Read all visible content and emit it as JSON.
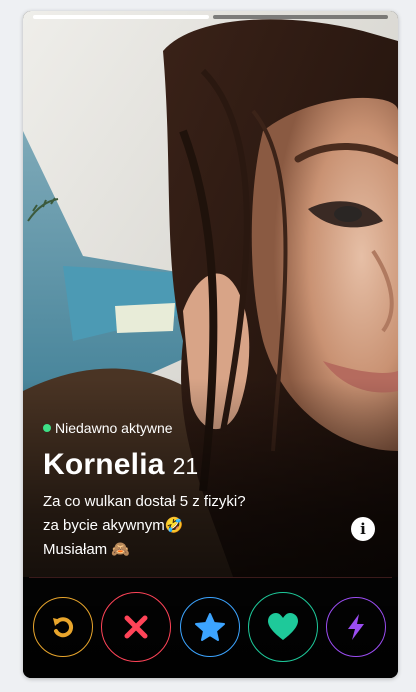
{
  "progress": {
    "total": 2,
    "active_index": 0
  },
  "profile": {
    "status": "Niedawno aktywne",
    "name": "Kornelia",
    "age": "21",
    "bio": [
      "Za co wulkan dostał 5 z fizyki?",
      "za bycie akywnym🤣",
      "Musiałam 🙈"
    ]
  },
  "actions": [
    {
      "name": "rewind",
      "icon": "rewind-icon",
      "color": "#e8a52c"
    },
    {
      "name": "nope",
      "icon": "close-icon",
      "color": "#ff4458"
    },
    {
      "name": "super-like",
      "icon": "star-icon",
      "color": "#3ca4ff"
    },
    {
      "name": "like",
      "icon": "heart-icon",
      "color": "#1ec99a"
    },
    {
      "name": "boost",
      "icon": "lightning-icon",
      "color": "#9b4df2"
    }
  ],
  "colors": {
    "status_dot": "#3ee087",
    "info_button": "#ffffff"
  }
}
